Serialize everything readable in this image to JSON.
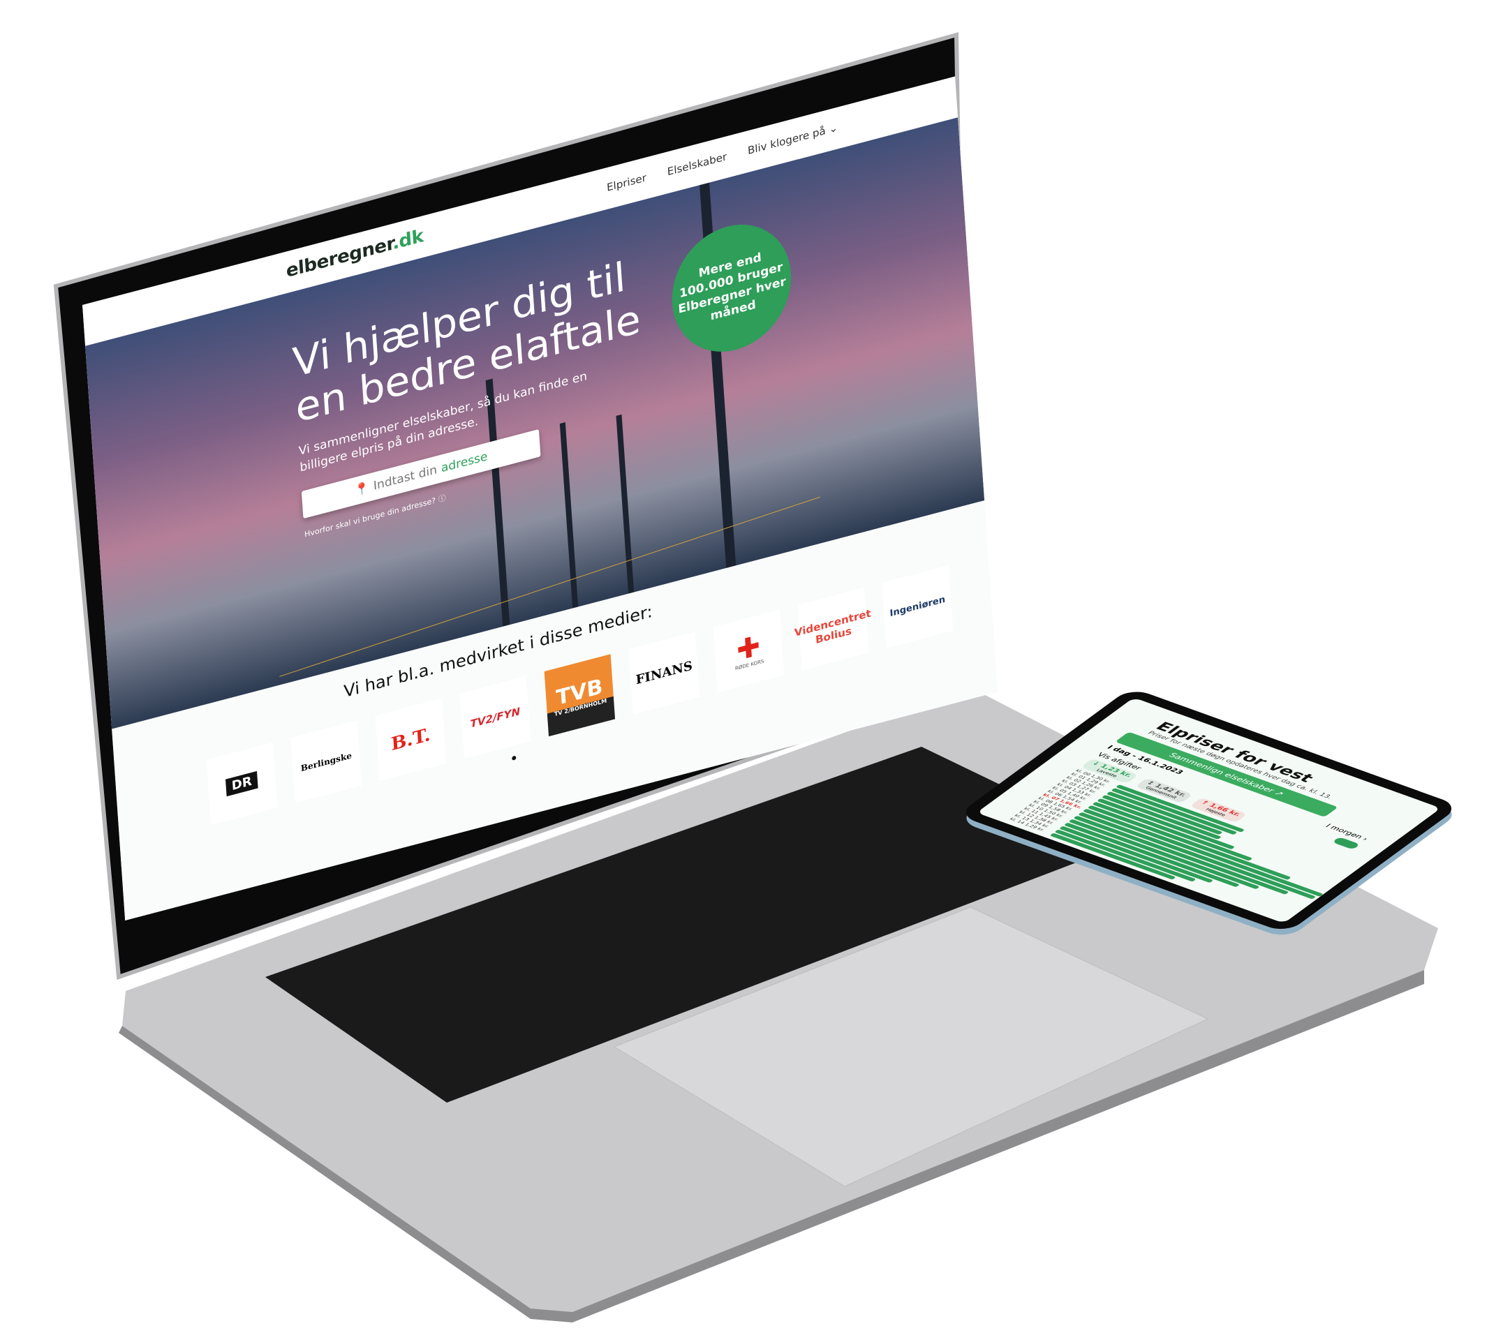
{
  "site": {
    "logo_text": "elberegner",
    "logo_tld": ".dk",
    "nav": [
      "Elpriser",
      "Elselskaber",
      "Bliv klogere på ⌄"
    ],
    "hero": {
      "title": "Vi hjælper dig til en bedre elaftale",
      "subtitle": "Vi sammenligner elselskaber, så du kan finde en billigere elpris på din adresse.",
      "address_placeholder_prefix": "Indtast din",
      "address_placeholder_accent": "adresse",
      "why_link": "Hvorfor skal vi bruge din adresse? ⓘ",
      "badge": "Mere end 100.000 bruger Elberegner hver måned"
    },
    "media": {
      "heading": "Vi har bl.a. medvirket i disse medier:",
      "logos": [
        "DR",
        "Berlingske",
        "B.T.",
        "TV2/FYN",
        "TV 2/BORNHOLM",
        "FINANS",
        "RØDE KORS",
        "Videncentret Bolius",
        "Ingeniøren"
      ]
    }
  },
  "phone": {
    "title": "Elpriser for vest",
    "subtitle": "Priser for næste døgn opdateres hver dag ca. kl. 13.",
    "compare_button": "Sammenlign elselskaber ↗",
    "tomorrow": "I morgen ›",
    "today": "I dag - 16.1.2023",
    "show_fees": "Vis afgifter",
    "stats": [
      {
        "value": "↓ 1,23 kr.",
        "label": "Laveste",
        "color": "#2e9e58"
      },
      {
        "value": "↕ 1,42 kr.",
        "label": "Gennemsnit",
        "color": "#555555"
      },
      {
        "value": "↑ 1,66 kr.",
        "label": "Højeste",
        "color": "#e03131"
      }
    ],
    "hours": [
      {
        "h": "kl. 00",
        "p": "1,30 kr.",
        "v": 1.3
      },
      {
        "h": "kl. 01",
        "p": "1,29 kr.",
        "v": 1.29
      },
      {
        "h": "kl. 02",
        "p": "1,26 kr.",
        "v": 1.26
      },
      {
        "h": "kl. 03",
        "p": "1,27 kr.",
        "v": 1.27
      },
      {
        "h": "kl. 04",
        "p": "1,33 kr.",
        "v": 1.33
      },
      {
        "h": "kl. 05",
        "p": "1,40 kr.",
        "v": 1.4
      },
      {
        "h": "kl. 06",
        "p": "1,54 kr.",
        "v": 1.54
      },
      {
        "h": "kl. 07",
        "p": "1,66 kr.",
        "v": 1.66
      },
      {
        "h": "kl. 08",
        "p": "1,65 kr.",
        "v": 1.65
      },
      {
        "h": "kl. 09",
        "p": "1,58 kr.",
        "v": 1.58
      },
      {
        "h": "kl. 10",
        "p": "1,50 kr.",
        "v": 1.5
      },
      {
        "h": "kl. 11",
        "p": "1,45 kr.",
        "v": 1.45
      },
      {
        "h": "kl. 12",
        "p": "1,38 kr.",
        "v": 1.38
      },
      {
        "h": "kl. 13",
        "p": "1,34 kr.",
        "v": 1.34
      },
      {
        "h": "kl. 14",
        "p": "1,29 kr.",
        "v": 1.29
      }
    ]
  },
  "colors": {
    "brand_green": "#2e9e58",
    "peak_red": "#e03131"
  }
}
